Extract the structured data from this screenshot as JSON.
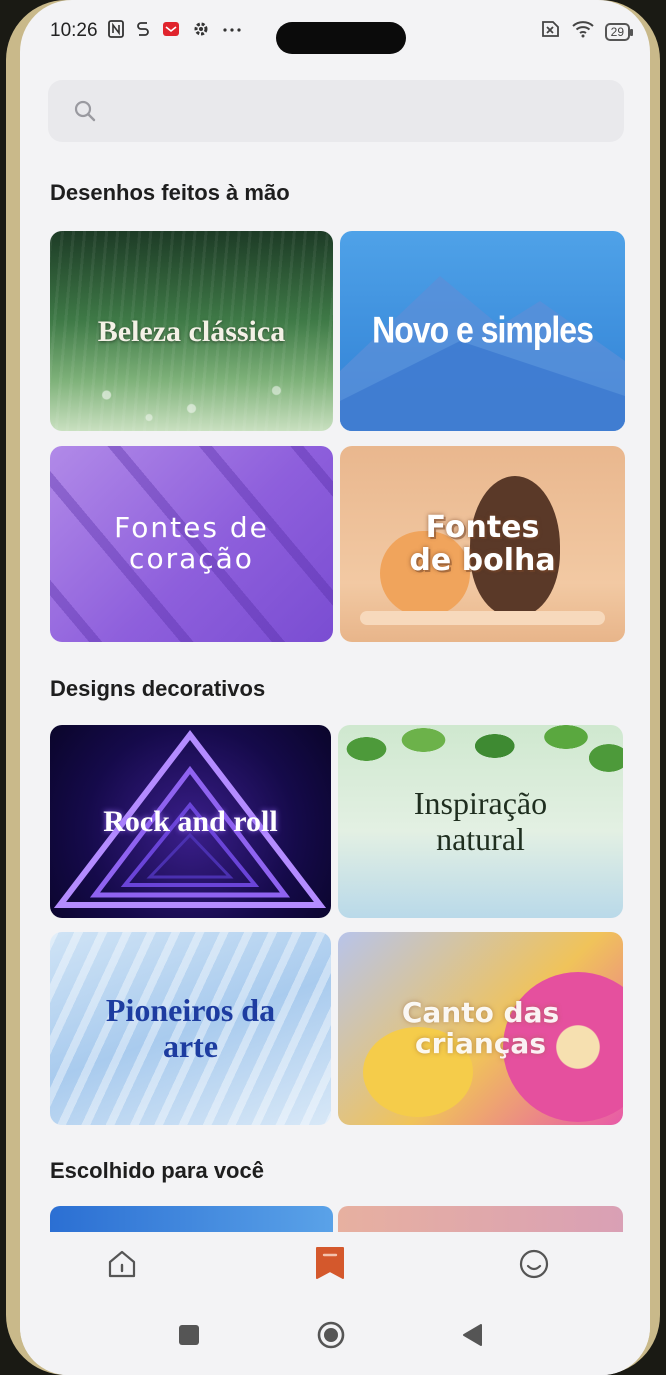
{
  "status_bar": {
    "time": "10:26",
    "battery": "29",
    "left_icons": [
      "nfc-icon",
      "sync-icon",
      "mail-icon",
      "settings-icon",
      "more-dots-icon"
    ],
    "right_icons": [
      "sim-off-icon",
      "wifi-icon",
      "battery-icon"
    ]
  },
  "search": {
    "placeholder": ""
  },
  "sections": [
    {
      "title": "Desenhos feitos à mão",
      "cards": [
        {
          "label": "Beleza clássica"
        },
        {
          "label": "Novo e simples"
        },
        {
          "label": "Fontes de coração"
        },
        {
          "label": "Fontes de bolha"
        }
      ]
    },
    {
      "title": "Designs decorativos",
      "cards": [
        {
          "label": "Rock and roll"
        },
        {
          "label": "Inspiração natural"
        },
        {
          "label": "Pioneiros da arte"
        },
        {
          "label": "Canto das crianças"
        }
      ]
    },
    {
      "title": "Escolhido para você",
      "cards": []
    }
  ],
  "bottom_nav": {
    "items": [
      {
        "icon": "home-icon",
        "active": false
      },
      {
        "icon": "bookmark-icon",
        "active": true
      },
      {
        "icon": "profile-smile-icon",
        "active": false
      }
    ]
  },
  "system_nav": {
    "items": [
      "recents-square-icon",
      "home-circle-icon",
      "back-triangle-icon"
    ]
  },
  "colors": {
    "accent": "#d4582c",
    "background": "#f3f3f5",
    "search_bg": "#e9e9ec"
  }
}
